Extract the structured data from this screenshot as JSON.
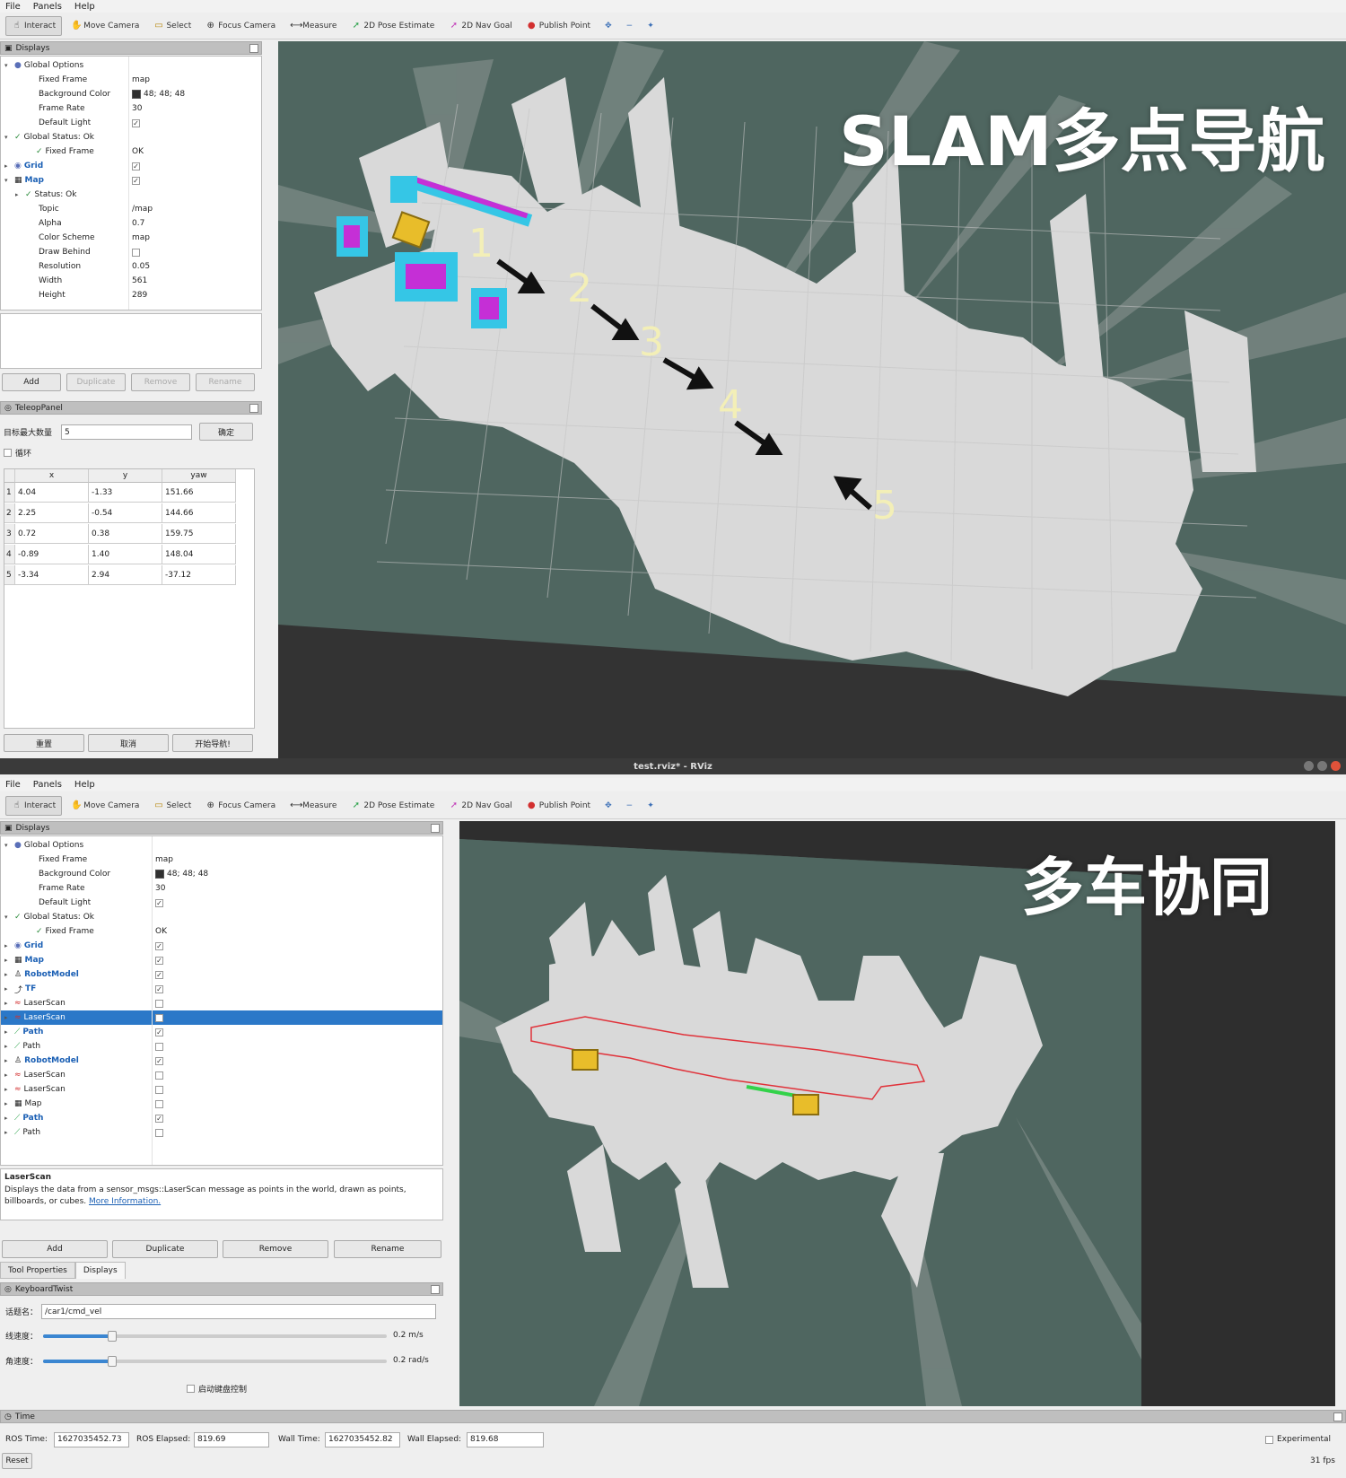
{
  "window_top": {
    "menu": [
      "File",
      "Panels",
      "Help"
    ],
    "tools": [
      {
        "label": "Interact",
        "icon": "hand-icon",
        "active": true
      },
      {
        "label": "Move Camera",
        "icon": "move-camera-icon"
      },
      {
        "label": "Select",
        "icon": "select-icon"
      },
      {
        "label": "Focus Camera",
        "icon": "focus-camera-icon"
      },
      {
        "label": "Measure",
        "icon": "measure-icon"
      },
      {
        "label": "2D Pose Estimate",
        "icon": "pose-estimate-icon"
      },
      {
        "label": "2D Nav Goal",
        "icon": "nav-goal-icon"
      },
      {
        "label": "Publish Point",
        "icon": "publish-point-icon"
      }
    ],
    "tool_extras": [
      "✥",
      "−",
      "✦"
    ],
    "displays_title": "Displays",
    "display_rows": [
      {
        "label": "Global Options",
        "value": "",
        "indent": 0,
        "expand": "▾",
        "icon": "●",
        "bold": false
      },
      {
        "label": "Fixed Frame",
        "value": "map",
        "indent": 2,
        "expand": "",
        "icon": ""
      },
      {
        "label": "Background Color",
        "value": "48; 48; 48",
        "indent": 2,
        "expand": "",
        "icon": "",
        "swatch": true
      },
      {
        "label": "Frame Rate",
        "value": "30",
        "indent": 2,
        "expand": "",
        "icon": ""
      },
      {
        "label": "Default Light",
        "value": "✓",
        "indent": 2,
        "expand": "",
        "icon": "",
        "check": true
      },
      {
        "label": "Global Status: Ok",
        "value": "",
        "indent": 0,
        "expand": "▾",
        "icon": "✓"
      },
      {
        "label": "Fixed Frame",
        "value": "OK",
        "indent": 2,
        "expand": "",
        "icon": "✓"
      },
      {
        "label": "Grid",
        "value": "✓",
        "indent": 0,
        "expand": "▸",
        "icon": "◉",
        "blue": true,
        "check": true
      },
      {
        "label": "Map",
        "value": "✓",
        "indent": 0,
        "expand": "▾",
        "icon": "▦",
        "blue": true,
        "check": true
      },
      {
        "label": "Status: Ok",
        "value": "",
        "indent": 1,
        "expand": "▸",
        "icon": "✓"
      },
      {
        "label": "Topic",
        "value": "/map",
        "indent": 2,
        "expand": "",
        "icon": ""
      },
      {
        "label": "Alpha",
        "value": "0.7",
        "indent": 2,
        "expand": "",
        "icon": ""
      },
      {
        "label": "Color Scheme",
        "value": "map",
        "indent": 2,
        "expand": "",
        "icon": ""
      },
      {
        "label": "Draw Behind",
        "value": "",
        "indent": 2,
        "expand": "",
        "icon": "",
        "check": true
      },
      {
        "label": "Resolution",
        "value": "0.05",
        "indent": 2,
        "expand": "",
        "icon": ""
      },
      {
        "label": "Width",
        "value": "561",
        "indent": 2,
        "expand": "",
        "icon": ""
      },
      {
        "label": "Height",
        "value": "289",
        "indent": 2,
        "expand": "",
        "icon": ""
      }
    ],
    "buttons": {
      "add": "Add",
      "duplicate": "Duplicate",
      "remove": "Remove",
      "rename": "Rename"
    },
    "teleop_title": "TeleopPanel",
    "goal_max_label": "目标最大数量",
    "goal_max_value": "5",
    "confirm_label": "确定",
    "loop_label": "循环",
    "table_headers": [
      "x",
      "y",
      "yaw"
    ],
    "table_rows": [
      {
        "idx": "1",
        "x": "4.04",
        "y": "-1.33",
        "yaw": "151.66"
      },
      {
        "idx": "2",
        "x": "2.25",
        "y": "-0.54",
        "yaw": "144.66"
      },
      {
        "idx": "3",
        "x": "0.72",
        "y": "0.38",
        "yaw": "159.75"
      },
      {
        "idx": "4",
        "x": "-0.89",
        "y": "1.40",
        "yaw": "148.04"
      },
      {
        "idx": "5",
        "x": "-3.34",
        "y": "2.94",
        "yaw": "-37.12"
      }
    ],
    "bottom_buttons": [
      "重置",
      "取消",
      "开始导航!"
    ],
    "overlay_title": "SLAM多点导航",
    "waypoint_labels": [
      "1",
      "2",
      "3",
      "4",
      "5"
    ]
  },
  "window_bottom": {
    "title": "test.rviz* - RViz",
    "menu": [
      "File",
      "Panels",
      "Help"
    ],
    "tools": [
      {
        "label": "Interact",
        "icon": "hand-icon",
        "active": true
      },
      {
        "label": "Move Camera",
        "icon": "move-camera-icon"
      },
      {
        "label": "Select",
        "icon": "select-icon"
      },
      {
        "label": "Focus Camera",
        "icon": "focus-camera-icon"
      },
      {
        "label": "Measure",
        "icon": "measure-icon"
      },
      {
        "label": "2D Pose Estimate",
        "icon": "pose-estimate-icon"
      },
      {
        "label": "2D Nav Goal",
        "icon": "nav-goal-icon"
      },
      {
        "label": "Publish Point",
        "icon": "publish-point-icon"
      }
    ],
    "tool_extras": [
      "✥",
      "−",
      "✦"
    ],
    "displays_title": "Displays",
    "display_rows": [
      {
        "label": "Global Options",
        "value": "",
        "indent": 0,
        "expand": "▾",
        "icon": "●"
      },
      {
        "label": "Fixed Frame",
        "value": "map",
        "indent": 2,
        "expand": "",
        "icon": ""
      },
      {
        "label": "Background Color",
        "value": "48; 48; 48",
        "indent": 2,
        "expand": "",
        "icon": "",
        "swatch": true
      },
      {
        "label": "Frame Rate",
        "value": "30",
        "indent": 2,
        "expand": "",
        "icon": ""
      },
      {
        "label": "Default Light",
        "value": "✓",
        "indent": 2,
        "expand": "",
        "icon": "",
        "check": true
      },
      {
        "label": "Global Status: Ok",
        "value": "",
        "indent": 0,
        "expand": "▾",
        "icon": "✓"
      },
      {
        "label": "Fixed Frame",
        "value": "OK",
        "indent": 2,
        "expand": "",
        "icon": "✓"
      },
      {
        "label": "Grid",
        "value": "✓",
        "indent": 0,
        "expand": "▸",
        "icon": "◉",
        "blue": true,
        "check": true
      },
      {
        "label": "Map",
        "value": "✓",
        "indent": 0,
        "expand": "▸",
        "icon": "▦",
        "blue": true,
        "check": true
      },
      {
        "label": "RobotModel",
        "value": "✓",
        "indent": 0,
        "expand": "▸",
        "icon": "♙",
        "blue": true,
        "check": true
      },
      {
        "label": "TF",
        "value": "✓",
        "indent": 0,
        "expand": "▸",
        "icon": "⤴",
        "blue": true,
        "check": true
      },
      {
        "label": "LaserScan",
        "value": "",
        "indent": 0,
        "expand": "▸",
        "icon": "≈",
        "check": true
      },
      {
        "label": "LaserScan",
        "value": "",
        "indent": 0,
        "expand": "▸",
        "icon": "≈",
        "check": true,
        "selected": true
      },
      {
        "label": "Path",
        "value": "✓",
        "indent": 0,
        "expand": "▸",
        "icon": "⟋",
        "blue": true,
        "check": true
      },
      {
        "label": "Path",
        "value": "",
        "indent": 0,
        "expand": "▸",
        "icon": "⟋",
        "check": true
      },
      {
        "label": "RobotModel",
        "value": "✓",
        "indent": 0,
        "expand": "▸",
        "icon": "♙",
        "blue": true,
        "check": true
      },
      {
        "label": "LaserScan",
        "value": "",
        "indent": 0,
        "expand": "▸",
        "icon": "≈",
        "check": true
      },
      {
        "label": "LaserScan",
        "value": "",
        "indent": 0,
        "expand": "▸",
        "icon": "≈",
        "check": true
      },
      {
        "label": "Map",
        "value": "",
        "indent": 0,
        "expand": "▸",
        "icon": "▦",
        "check": true
      },
      {
        "label": "Path",
        "value": "✓",
        "indent": 0,
        "expand": "▸",
        "icon": "⟋",
        "blue": true,
        "check": true
      },
      {
        "label": "Path",
        "value": "",
        "indent": 0,
        "expand": "▸",
        "icon": "⟋",
        "check": true
      }
    ],
    "desc_title": "LaserScan",
    "desc_text": "Displays the data from a sensor_msgs::LaserScan message as points in the world, drawn as points, billboards, or cubes.",
    "desc_link": "More Information.",
    "buttons": {
      "add": "Add",
      "duplicate": "Duplicate",
      "remove": "Remove",
      "rename": "Rename"
    },
    "tabs": [
      "Tool Properties",
      "Displays"
    ],
    "keyboard_title": "KeyboardTwist",
    "topic_label": "话题名：",
    "topic_value": "/car1/cmd_vel",
    "linear_label": "线速度：",
    "linear_value": "0.2 m/s",
    "linear_level": 0.2,
    "angular_label": "角速度：",
    "angular_value": "0.2 rad/s",
    "angular_level": 0.2,
    "keyboard_check_label": "启动键盘控制",
    "time_title": "Time",
    "ros_time_label": "ROS Time:",
    "ros_time_value": "1627035452.73",
    "ros_elapsed_label": "ROS Elapsed:",
    "ros_elapsed_value": "819.69",
    "wall_time_label": "Wall Time:",
    "wall_time_value": "1627035452.82",
    "wall_elapsed_label": "Wall Elapsed:",
    "wall_elapsed_value": "819.68",
    "experimental_label": "Experimental",
    "reset_label": "Reset",
    "fps_label": "31 fps",
    "overlay_title": "多车协同"
  },
  "colors": {
    "map_bg": "#4f6660",
    "map_free": "#d9d9d9",
    "laser": "#35c6e6",
    "inflation": "#c52fd6",
    "robot": "#e8bd2a",
    "path_red": "#e0323a",
    "path_green": "#33d24a",
    "selection": "#2b78c8"
  }
}
